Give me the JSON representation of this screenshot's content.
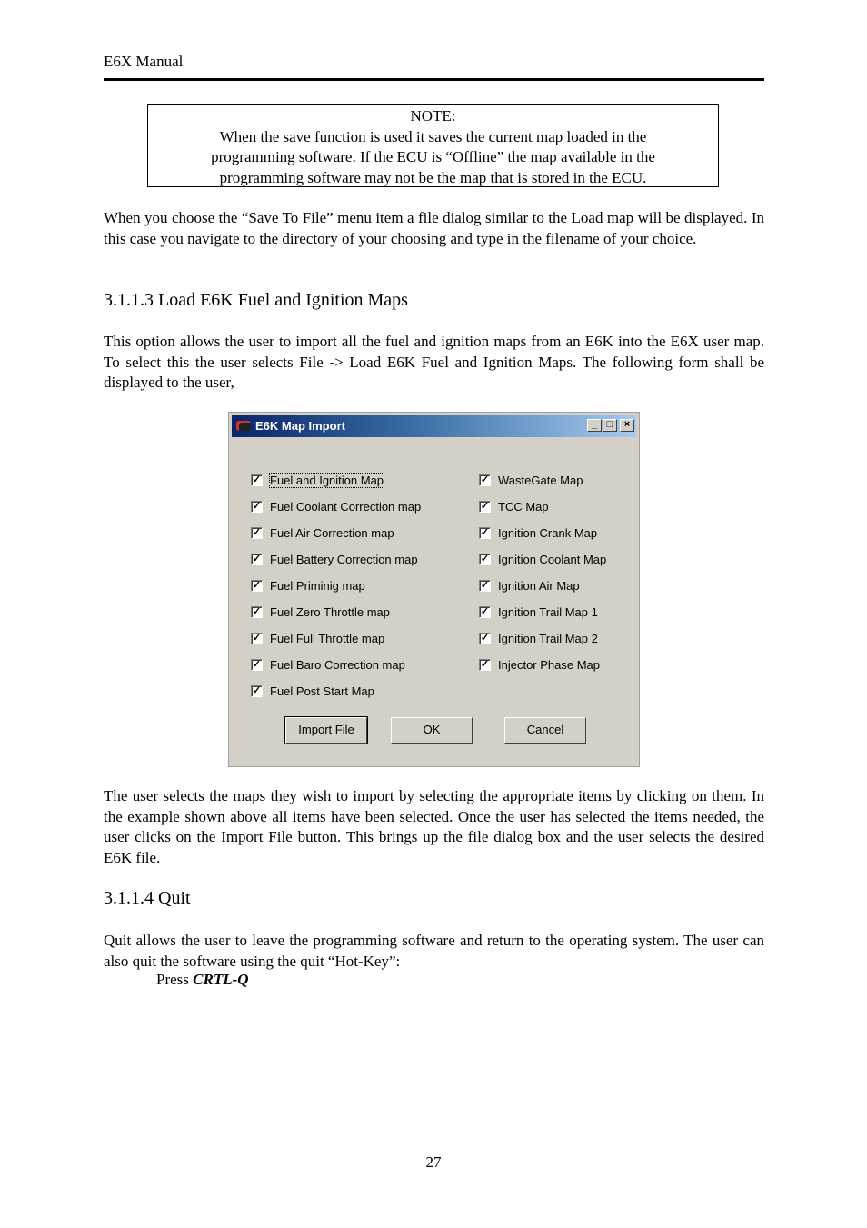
{
  "header": {
    "title": "E6X Manual"
  },
  "note": {
    "label": "NOTE:",
    "lines": [
      "When the save function is used it saves the current map loaded in the",
      "programming software.  If the ECU is “Offline” the map available in the",
      "programming software may not be the map that is stored in the ECU."
    ]
  },
  "paragraphs": {
    "save_to_file": "When you choose the “Save To File” menu item a file dialog similar to the Load map will be displayed. In this case you navigate to the directory of your choosing and type in the filename of your choice.",
    "load_e6k": "This option allows the user to import all the fuel and ignition maps from an E6K into the E6X user map. To select this the user selects File -> Load E6K Fuel and Ignition Maps. The following form shall be displayed to the user,",
    "after_dialog": "The user selects the maps they wish to import by selecting the appropriate items by clicking on them. In the example shown above all items have been selected. Once the user has selected the items needed, the user clicks on the Import File button. This brings up the file dialog box and the user selects the desired E6K file.",
    "quit": "Quit allows the user to leave the programming software and return to the operating system. The user can also quit the software using the quit “Hot-Key”:",
    "press_prefix": "Press ",
    "hotkey": "CRTL-Q"
  },
  "headings": {
    "load_e6k": "3.1.1.3 Load E6K Fuel and Ignition Maps",
    "quit": "3.1.1.4 Quit"
  },
  "dialog": {
    "title": "E6K Map Import",
    "controls": {
      "minimize": "_",
      "maximize": "□",
      "close": "×"
    },
    "check_glyph": "✓",
    "left_column": [
      {
        "label": "Fuel and Ignition Map",
        "checked": true
      },
      {
        "label": "Fuel Coolant Correction map",
        "checked": true
      },
      {
        "label": "Fuel Air Correction map",
        "checked": true
      },
      {
        "label": "Fuel Battery Correction map",
        "checked": true
      },
      {
        "label": "Fuel Priminig map",
        "checked": true
      },
      {
        "label": "Fuel Zero Throttle map",
        "checked": true
      },
      {
        "label": "Fuel Full Throttle map",
        "checked": true
      },
      {
        "label": "Fuel Baro Correction map",
        "checked": true
      },
      {
        "label": "Fuel Post Start Map",
        "checked": true
      }
    ],
    "right_column": [
      {
        "label": "WasteGate Map",
        "checked": true
      },
      {
        "label": "TCC Map",
        "checked": true
      },
      {
        "label": "Ignition Crank Map",
        "checked": true
      },
      {
        "label": "Ignition Coolant Map",
        "checked": true
      },
      {
        "label": "Ignition Air Map",
        "checked": true
      },
      {
        "label": "Ignition Trail Map 1",
        "checked": true
      },
      {
        "label": "Ignition Trail Map 2",
        "checked": true
      },
      {
        "label": "Injector Phase Map",
        "checked": true
      }
    ],
    "buttons": {
      "import": "Import File",
      "ok": "OK",
      "cancel": "Cancel"
    }
  },
  "footer": {
    "page_number": "27"
  }
}
